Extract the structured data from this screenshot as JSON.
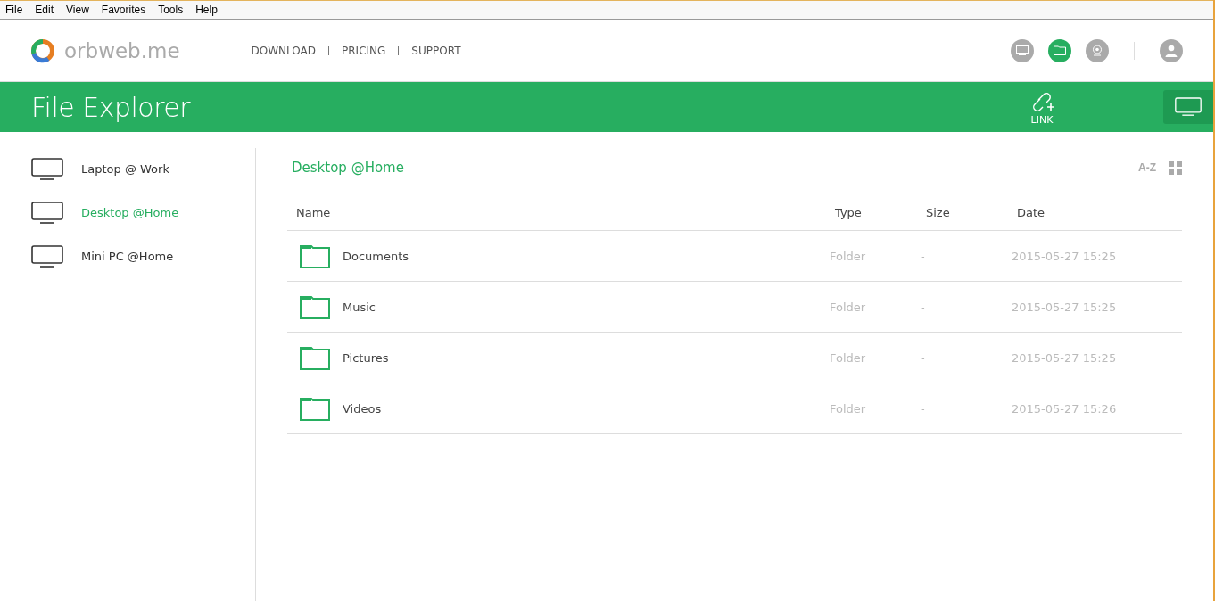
{
  "menu_bar": [
    "File",
    "Edit",
    "View",
    "Favorites",
    "Tools",
    "Help"
  ],
  "header": {
    "logo_text": "orbweb.me",
    "nav": [
      "DOWNLOAD",
      "PRICING",
      "SUPPORT"
    ],
    "mode_buttons": [
      {
        "kind": "screen",
        "selected": false
      },
      {
        "kind": "folder",
        "selected": true
      },
      {
        "kind": "webcam",
        "selected": false
      }
    ]
  },
  "title_bar": {
    "title": "File Explorer",
    "link_label": "LINK"
  },
  "sidebar": {
    "items": [
      {
        "label": "Laptop @ Work",
        "selected": false
      },
      {
        "label": "Desktop @Home",
        "selected": true
      },
      {
        "label": "Mini PC @Home",
        "selected": false
      }
    ]
  },
  "content": {
    "heading": "Desktop @Home",
    "sort_label": "A-Z",
    "table": {
      "columns": [
        "Name",
        "Type",
        "Size",
        "Date"
      ],
      "rows": [
        {
          "name": "Documents",
          "type": "Folder",
          "size": "-",
          "date": "2015-05-27 15:25"
        },
        {
          "name": "Music",
          "type": "Folder",
          "size": "-",
          "date": "2015-05-27 15:25"
        },
        {
          "name": "Pictures",
          "type": "Folder",
          "size": "-",
          "date": "2015-05-27 15:25"
        },
        {
          "name": "Videos",
          "type": "Folder",
          "size": "-",
          "date": "2015-05-27 15:26"
        }
      ]
    }
  }
}
